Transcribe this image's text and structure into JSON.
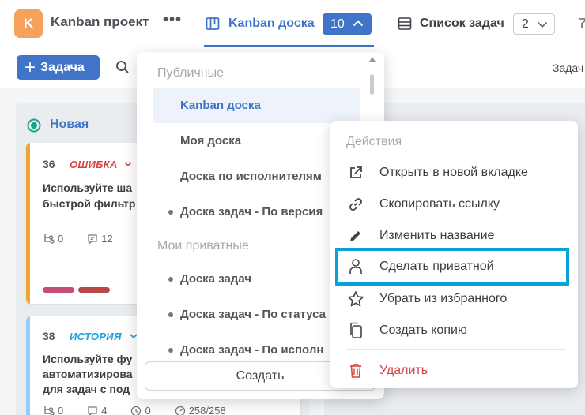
{
  "header": {
    "avatar_letter": "K",
    "project_title": "Kanban проект",
    "more_label": "•••",
    "tab_kanban": {
      "label": "Kanban доска",
      "count": "10"
    },
    "tab_list": {
      "label": "Список задач",
      "count": "2"
    }
  },
  "toolbar": {
    "add_task_label": "Задача",
    "right_label": "Задач"
  },
  "column": {
    "title": "Новая"
  },
  "cards": [
    {
      "number": "36",
      "type": "ОШИБКА",
      "type_color": "#d64343",
      "stripe_color": "#f2a531",
      "line1": "Используйте ша",
      "line2": "быстрой фильтр",
      "line3": "",
      "subtasks": "0",
      "comments": "12",
      "timer": "",
      "progress": ""
    },
    {
      "number": "38",
      "type": "ИСТОРИЯ",
      "type_color": "#1ba1e2",
      "stripe_color": "#8fd0f3",
      "line1": "Используйте фу",
      "line2": "автоматизирова",
      "line3": "для задач с под",
      "subtasks": "0",
      "comments": "4",
      "timer": "0",
      "progress": "258/258"
    }
  ],
  "boards_menu": {
    "public_section": "Публичные",
    "public_items": [
      "Kanban доска",
      "Моя доска",
      "Доска по исполнителям",
      "Доска задач - По версия"
    ],
    "private_section": "Мои приватные",
    "private_items": [
      "Доска задач",
      "Доска задач - По статуса",
      "Доска задач - По исполн"
    ],
    "create_label": "Создать"
  },
  "actions_menu": {
    "title": "Действия",
    "items": [
      {
        "label": "Открыть в новой вкладке",
        "icon": "external-link-icon"
      },
      {
        "label": "Скопировать ссылку",
        "icon": "link-icon"
      },
      {
        "label": "Изменить название",
        "icon": "pencil-icon"
      },
      {
        "label": "Сделать приватной",
        "icon": "user-icon"
      },
      {
        "label": "Убрать из избранного",
        "icon": "star-icon"
      },
      {
        "label": "Создать копию",
        "icon": "copy-icon"
      }
    ],
    "delete_label": "Удалить"
  },
  "colors": {
    "accent": "#3f74c9",
    "danger": "#d64343",
    "highlight_border": "#0aa0d8",
    "avatar": "#f5a25d"
  }
}
